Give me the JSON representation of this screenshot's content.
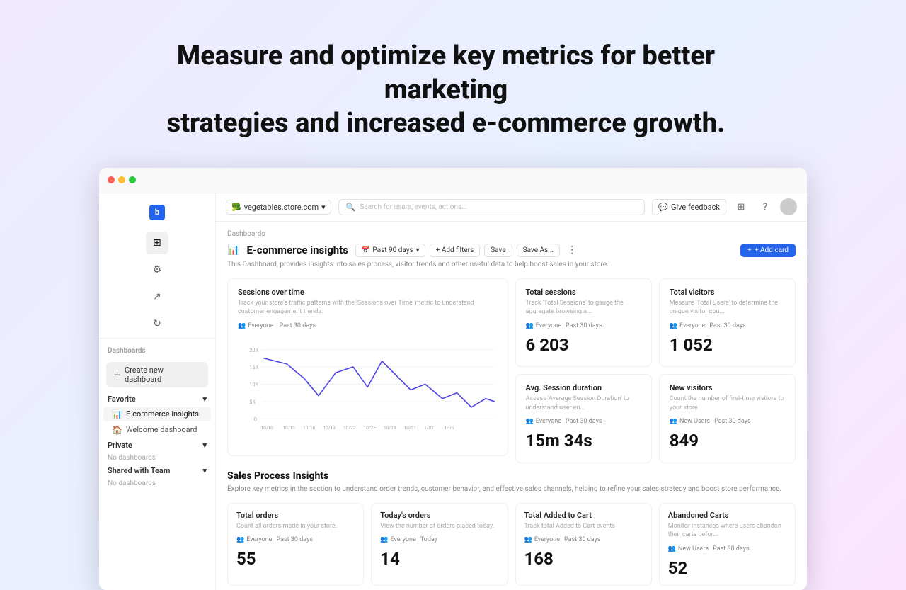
{
  "hero": {
    "line1": "Measure and optimize key metrics for better marketing",
    "line2": "strategies and increased e-commerce growth."
  },
  "browser": {
    "store_name": "vegetables.store.com",
    "search_placeholder": "Search for users, events, actions...",
    "feedback_label": "Give feedback"
  },
  "sidebar": {
    "logo": "b",
    "nav_icons": [
      "⊞",
      "⚙",
      "↗",
      "↻"
    ],
    "dashboards_label": "Dashboards",
    "create_btn": "Create new dashboard",
    "favorite": {
      "label": "Favorite",
      "items": [
        {
          "icon": "📊",
          "label": "E-commerce insights",
          "active": true
        },
        {
          "icon": "🏠",
          "label": "Welcome dashboard"
        }
      ]
    },
    "private": {
      "label": "Private",
      "no_dash": "No dashboards"
    },
    "shared": {
      "label": "Shared with Team",
      "no_dash": "No dashboards"
    }
  },
  "topnav": {
    "store": "vegetables.store.com",
    "search_placeholder": "Search for users, events, actions...",
    "feedback": "Give feedback"
  },
  "dashboard": {
    "breadcrumb": "Dashboards",
    "title": "E-commerce insights",
    "title_icon": "📊",
    "description": "This Dashboard, provides insights into sales process, visitor trends and other useful data to help boost sales in your store.",
    "time_filter": "Past 90 days",
    "add_filter": "+ Add filters",
    "save": "Save",
    "save_as": "Save As...",
    "add_card": "+ Add card"
  },
  "sessions_chart": {
    "title": "Sessions over time",
    "desc": "Track your store's traffic patterns with the 'Sessions over Time' metric to understand customer engagement trends.",
    "filter_audience": "Everyone",
    "filter_time": "Past 30 days",
    "y_labels": [
      "20K",
      "15K",
      "10K",
      "5K",
      "0"
    ],
    "x_labels": [
      "10/10",
      "10/13",
      "10/16",
      "10/19",
      "10/22",
      "10/25",
      "10/28",
      "10/31",
      "1/02",
      "1/05"
    ]
  },
  "metrics": {
    "total_sessions": {
      "title": "Total sessions",
      "desc": "Track 'Total Sessions' to gauge the aggregate browsing a...",
      "audience": "Everyone",
      "time": "Past 30 days",
      "value": "6 203"
    },
    "total_visitors": {
      "title": "Total visitors",
      "desc": "Measure 'Total Users' to determine the unique visitor cou...",
      "audience": "Everyone",
      "time": "Past 30 days",
      "value": "1 052"
    },
    "avg_session": {
      "title": "Avg. Session duration",
      "desc": "Assess 'Average Session Duration' to understand user en...",
      "audience": "Everyone",
      "time": "Past 30 days",
      "value": "15m 34s"
    },
    "new_visitors": {
      "title": "New visitors",
      "desc": "Count the number of first-time visitors to your store",
      "audience": "New Users",
      "time": "Past 30 days",
      "value": "849"
    }
  },
  "sales_section": {
    "title": "Sales Process Insights",
    "desc": "Explore key metrics in the section to understand order trends, customer behavior, and effective sales channels, helping to refine your sales strategy and boost store performance."
  },
  "bottom_cards": {
    "total_orders": {
      "title": "Total orders",
      "desc": "Count all orders made in your store.",
      "audience": "Everyone",
      "time": "Past 30 days",
      "value": "55"
    },
    "todays_orders": {
      "title": "Today's orders",
      "desc": "View the number of orders placed today.",
      "audience": "Everyone",
      "time": "Today",
      "value": "14"
    },
    "total_added_cart": {
      "title": "Total Added to Cart",
      "desc": "Track total Added to Cart events",
      "audience": "Everyone",
      "time": "Past 30 days",
      "value": "168"
    },
    "abandoned_carts": {
      "title": "Abandoned Carts",
      "desc": "Monitor instances where users abandon their carts befor...",
      "audience": "New Users",
      "time": "Past 30 days",
      "value": "52"
    }
  }
}
